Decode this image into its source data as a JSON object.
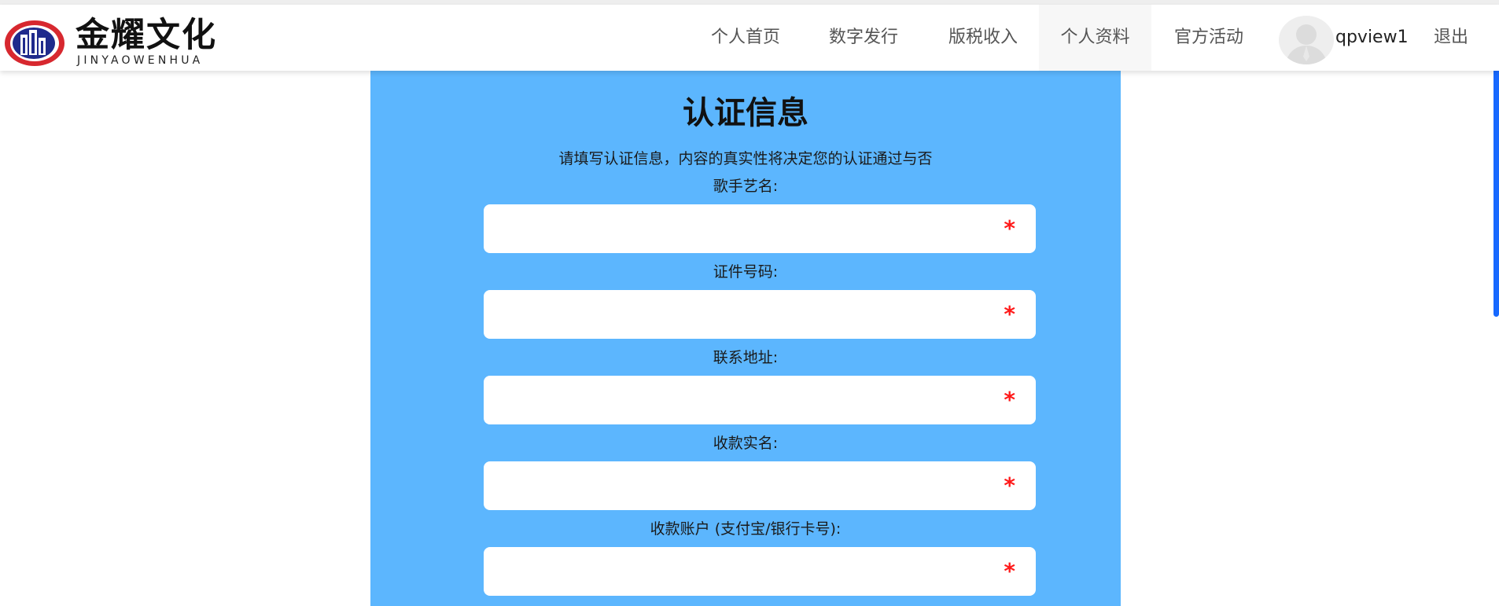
{
  "header": {
    "logo_cn": "金耀文化",
    "logo_en": "JINYAOWENHUA",
    "nav": [
      {
        "label": "个人首页"
      },
      {
        "label": "数字发行"
      },
      {
        "label": "版税收入"
      },
      {
        "label": "个人资料"
      },
      {
        "label": "官方活动"
      }
    ],
    "active_nav": "个人资料",
    "username": "qpview1",
    "logout_label": "退出"
  },
  "form": {
    "title": "认证信息",
    "subtitle": "请填写认证信息，内容的真实性将决定您的认证通过与否",
    "required_mark": "*",
    "fields": [
      {
        "label": "歌手艺名:",
        "value": ""
      },
      {
        "label": "证件号码:",
        "value": ""
      },
      {
        "label": "联系地址:",
        "value": ""
      },
      {
        "label": "收款实名:",
        "value": ""
      },
      {
        "label": "收款账户 (支付宝/银行卡号):",
        "value": ""
      }
    ]
  },
  "colors": {
    "panel_bg": "#5cb6fe",
    "required": "#ff1a1a",
    "scrollbar": "#1769ff"
  }
}
